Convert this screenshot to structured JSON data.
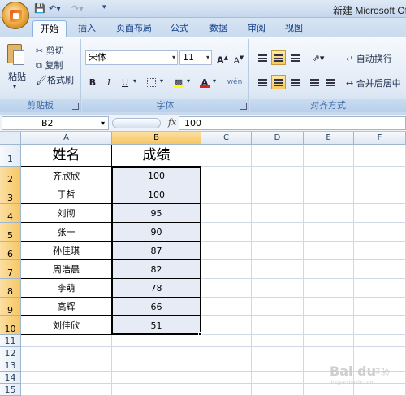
{
  "window": {
    "title": "新建 Microsoft Of"
  },
  "quick_access": {
    "save_icon": "save-icon",
    "undo_icon": "undo-icon",
    "redo_icon": "redo-icon"
  },
  "tabs": [
    "开始",
    "插入",
    "页面布局",
    "公式",
    "数据",
    "审阅",
    "视图"
  ],
  "active_tab": 0,
  "clipboard": {
    "paste": "粘贴",
    "cut": "剪切",
    "copy": "复制",
    "format_painter": "格式刷",
    "group": "剪贴板"
  },
  "font": {
    "name": "宋体",
    "size": "11",
    "bold": "B",
    "italic": "I",
    "underline": "U",
    "grow": "A",
    "shrink": "A",
    "color_letter": "A",
    "phonetic": "wén",
    "group": "字体"
  },
  "alignment": {
    "wrap": "自动换行",
    "merge": "合并后居中",
    "group": "对齐方式"
  },
  "formula_bar": {
    "cell_ref": "B2",
    "fx": "fx",
    "value": "100"
  },
  "columns": [
    "A",
    "B",
    "C",
    "D",
    "E",
    "F"
  ],
  "rows": [
    "1",
    "2",
    "3",
    "4",
    "5",
    "6",
    "7",
    "8",
    "9",
    "10",
    "11",
    "12",
    "13",
    "14",
    "15"
  ],
  "table": {
    "headers": [
      "姓名",
      "成绩"
    ],
    "rows": [
      [
        "齐欣欣",
        "100"
      ],
      [
        "于哲",
        "100"
      ],
      [
        "刘彻",
        "95"
      ],
      [
        "张一",
        "90"
      ],
      [
        "孙佳琪",
        "87"
      ],
      [
        "周浩晨",
        "82"
      ],
      [
        "李萌",
        "78"
      ],
      [
        "高辉",
        "66"
      ],
      [
        "刘佳欣",
        "51"
      ]
    ]
  },
  "colors": {
    "selection": "#e7ebf5",
    "header_highlight": "#f7c662",
    "ribbon": "#dfe9f5"
  }
}
